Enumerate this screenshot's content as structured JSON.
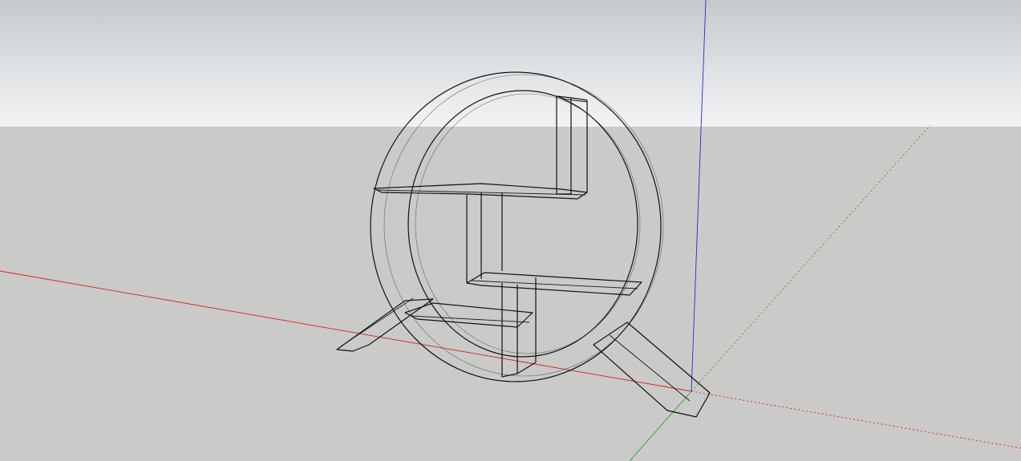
{
  "viewport": {
    "sky_color": "#e6e8ea",
    "ground_color": "#cacac8"
  },
  "axes": {
    "red_axis_color": "#cc1f1f",
    "green_axis_color": "#2aa52a",
    "blue_axis_color": "#2a2ad0"
  },
  "model": {
    "icon": "round-shelf-wireframe",
    "edge_color": "#111111"
  }
}
